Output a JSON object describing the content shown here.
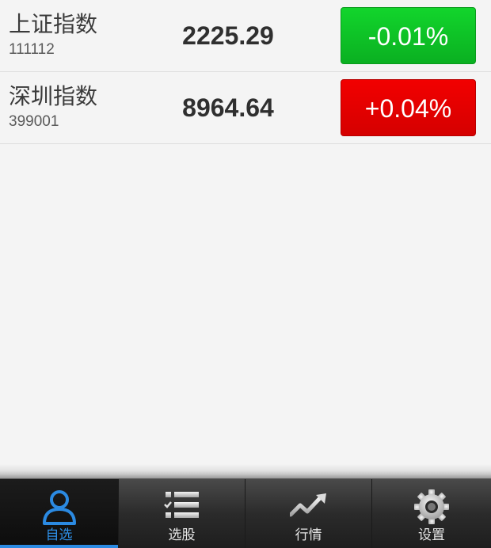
{
  "stocks": [
    {
      "name": "上证指数",
      "code": "111112",
      "price": "2225.29",
      "change": "-0.01%",
      "direction": "down",
      "color": "#0ab021"
    },
    {
      "name": "深圳指数",
      "code": "399001",
      "price": "8964.64",
      "change": "+0.04%",
      "direction": "up",
      "color": "#e00000"
    }
  ],
  "tabbar": {
    "tabs": [
      {
        "label": "自选",
        "icon": "user-icon",
        "active": true
      },
      {
        "label": "选股",
        "icon": "checklist-icon",
        "active": false
      },
      {
        "label": "行情",
        "icon": "trend-icon",
        "active": false
      },
      {
        "label": "设置",
        "icon": "gear-icon",
        "active": false
      }
    ],
    "active_color": "#2b8ae2"
  }
}
